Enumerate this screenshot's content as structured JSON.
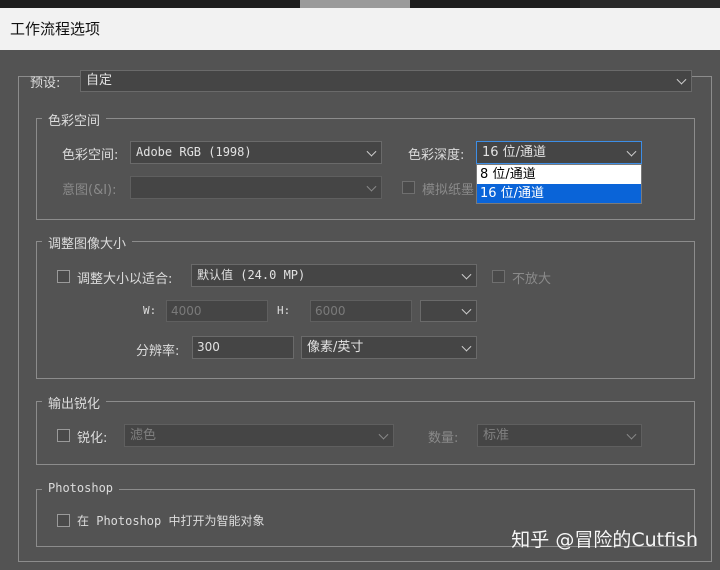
{
  "window": {
    "title": "工作流程选项"
  },
  "preset": {
    "label": "预设:",
    "value": "自定"
  },
  "color_space_group": {
    "title": "色彩空间",
    "space_label": "色彩空间:",
    "space_value": "Adobe RGB (1998)",
    "depth_label": "色彩深度:",
    "depth_value": "16 位/通道",
    "depth_options": [
      "8 位/通道",
      "16 位/通道"
    ],
    "intent_label": "意图(&I):",
    "intent_value": "",
    "simulate_paper_label": "模拟纸墨"
  },
  "resize_group": {
    "title": "调整图像大小",
    "fit_label": "调整大小以适合:",
    "fit_value": "默认值 (24.0 MP)",
    "no_enlarge_label": "不放大",
    "w_label": "W:",
    "w_value": "4000",
    "h_label": "H:",
    "h_value": "6000",
    "unit_value": "",
    "resolution_label": "分辨率:",
    "resolution_value": "300",
    "resolution_unit": "像素/英寸"
  },
  "sharpen_group": {
    "title": "输出锐化",
    "sharpen_label": "锐化:",
    "sharpen_value": "滤色",
    "amount_label": "数量:",
    "amount_value": "标准"
  },
  "photoshop_group": {
    "title": "Photoshop",
    "smart_object_label": "在 Photoshop 中打开为智能对象"
  },
  "watermark": {
    "text": "知乎 @冒险的Cutfish"
  }
}
